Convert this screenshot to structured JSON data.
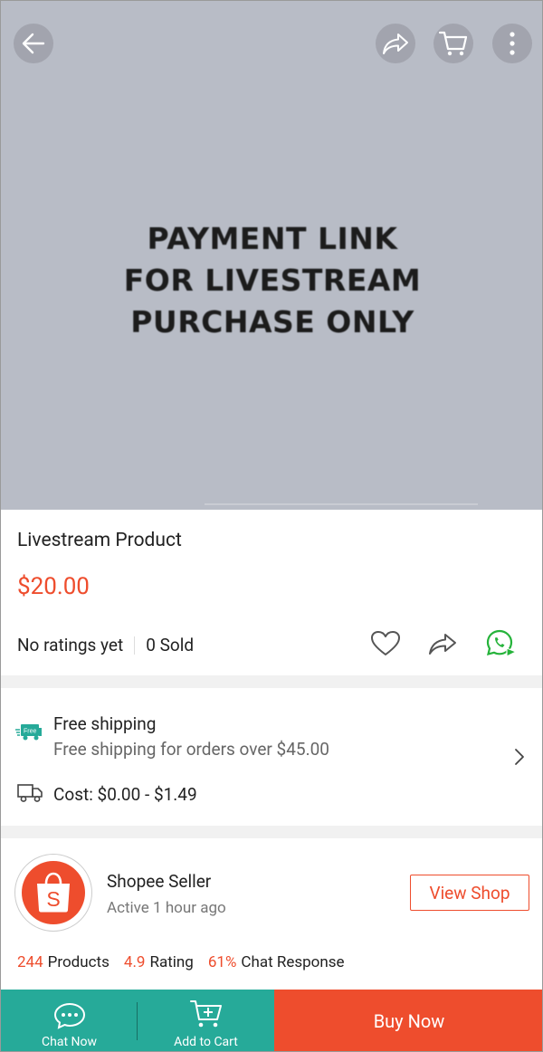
{
  "hero": {
    "image_text": [
      "PAYMENT LINK",
      "FOR LIVESTREAM",
      "PURCHASE ONLY"
    ],
    "buttons": {
      "back_icon": "back-arrow-icon",
      "share_icon": "share-icon",
      "cart_icon": "cart-icon",
      "more_icon": "more-vertical-icon"
    }
  },
  "product": {
    "title": "Livestream Product",
    "price": "$20.00",
    "ratings": "No ratings yet",
    "sold": "0 Sold",
    "actions": [
      "heart-icon",
      "share-icon",
      "whatsapp-icon"
    ]
  },
  "shipping": {
    "title": "Free shipping",
    "subtitle": "Free shipping for orders over $45.00",
    "cost": "Cost: $0.00 - $1.49",
    "badge": "Free"
  },
  "shop": {
    "name": "Shopee Seller",
    "active": "Active 1 hour ago",
    "view_shop": "View Shop",
    "logo_letter": "S",
    "stats": [
      {
        "value": "244",
        "label": "Products"
      },
      {
        "value": "4.9",
        "label": "Rating"
      },
      {
        "value": "61%",
        "label": "Chat Response"
      }
    ]
  },
  "bottom_bar": {
    "chat_now": "Chat Now",
    "add_to_cart": "Add to Cart",
    "buy_now": "Buy Now"
  },
  "colors": {
    "accent": "#ee4d2d",
    "teal": "#26aa99",
    "hero_bg": "#b8bcc6"
  }
}
